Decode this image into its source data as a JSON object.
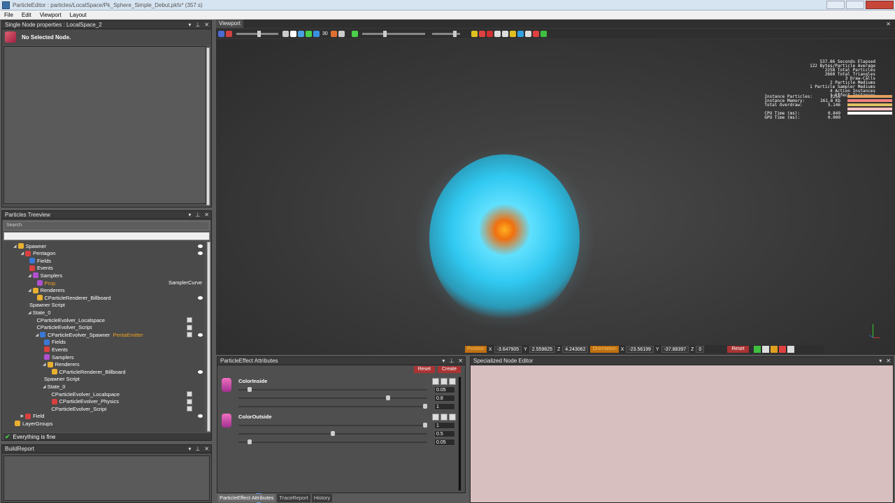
{
  "window": {
    "title": "ParticleEditor : particles/LocalSpace/Pk_Sphere_Simple_Debut.pkfx* (357 s)"
  },
  "menu": [
    "File",
    "Edit",
    "Viewport",
    "Layout"
  ],
  "node_props": {
    "title": "Single Node properties : LocalSpace_2",
    "no_selection": "No Selected Node."
  },
  "treeview": {
    "title": "Particles Treeview",
    "search_label": "Search",
    "rows": [
      {
        "label": "Spawner",
        "indent": 0,
        "icon": "folder",
        "tri": "◢"
      },
      {
        "label": "Pentagon",
        "indent": 1,
        "icon": "penta",
        "tri": "◢"
      },
      {
        "label": "Fields",
        "indent": 2,
        "icon": "blue",
        "tri": ""
      },
      {
        "label": "Events",
        "indent": 2,
        "icon": "penta",
        "tri": ""
      },
      {
        "label": "Samplers",
        "indent": 2,
        "icon": "purple",
        "tri": "◢"
      },
      {
        "label": "Prop",
        "indent": 3,
        "icon": "purple",
        "tri": "",
        "orange": true
      },
      {
        "label": "Renderers",
        "indent": 2,
        "icon": "folder",
        "tri": "◢"
      },
      {
        "label": "CParticleRenderer_Billboard",
        "indent": 3,
        "icon": "folder",
        "tri": ""
      },
      {
        "label": "Spawner Script",
        "indent": 2,
        "icon": "sphere",
        "tri": ""
      },
      {
        "label": "State_0",
        "indent": 2,
        "icon": "sphere",
        "tri": "◢"
      },
      {
        "label": "CParticleEvolver_Localspace",
        "indent": 3,
        "icon": "sphere",
        "tri": ""
      },
      {
        "label": "CParticleEvolver_Script",
        "indent": 3,
        "icon": "sphere",
        "tri": ""
      },
      {
        "label": "CParticleEvolver_Spawner",
        "indent": 3,
        "icon": "blue",
        "tri": "◢",
        "suffix": "PentaEmitter"
      },
      {
        "label": "Fields",
        "indent": 4,
        "icon": "blue",
        "tri": ""
      },
      {
        "label": "Events",
        "indent": 4,
        "icon": "penta",
        "tri": ""
      },
      {
        "label": "Samplers",
        "indent": 4,
        "icon": "purple",
        "tri": ""
      },
      {
        "label": "Renderers",
        "indent": 4,
        "icon": "folder",
        "tri": "◢"
      },
      {
        "label": "CParticleRenderer_Billboard",
        "indent": 5,
        "icon": "folder",
        "tri": ""
      },
      {
        "label": "Spawner Script",
        "indent": 4,
        "icon": "sphere",
        "tri": ""
      },
      {
        "label": "State_0",
        "indent": 4,
        "icon": "sphere",
        "tri": "◢"
      },
      {
        "label": "CParticleEvolver_Localspace",
        "indent": 5,
        "icon": "sphere",
        "tri": ""
      },
      {
        "label": "CParticleEvolver_Physics",
        "indent": 5,
        "icon": "penta",
        "tri": ""
      },
      {
        "label": "CParticleEvolver_Script",
        "indent": 5,
        "icon": "sphere",
        "tri": ""
      },
      {
        "label": "Field",
        "indent": 1,
        "icon": "penta",
        "tri": "▶"
      },
      {
        "label": "LayerGroups",
        "indent": 0,
        "icon": "folder",
        "tri": ""
      }
    ],
    "sampler_curve": "SamplerCurve",
    "status": "Everything is fine"
  },
  "build_report": {
    "title": "BuildReport"
  },
  "viewport": {
    "tab": "Viewport",
    "toolbar_value": "30",
    "stats_right": [
      "537.86 Seconds Elapsed",
      "122 Bytes/Particle Average",
      "2258 Total Particles",
      "2660 Total Triangles",
      "3 Draw-Calls",
      "2 Particle Mediums",
      "1 Particle Sampler Mediums",
      "4 Action Instances",
      "1 Effect Instances"
    ],
    "stats2_labels": [
      "Instance Particles:",
      "Instance Memory:",
      "Total Overdraw:",
      "",
      "CPU Time (ms):",
      "GPU Time (ms):"
    ],
    "stats2_values": [
      "2258",
      "261.8 Kb",
      "5.146",
      "",
      "0.849",
      "0.000"
    ],
    "position_label": "Position",
    "orientation_label": "Orientation",
    "pos_x": "-3.647905",
    "pos_y": "2.559825",
    "pos_z": "4.243062",
    "rot_x": "-23.56199",
    "rot_y": "-37.88397",
    "rot_z": "0",
    "reset": "Reset",
    "axes": {
      "x": "X",
      "y": "Y",
      "z": "Z"
    }
  },
  "attributes": {
    "title": "ParticleEffect Attributes",
    "reset": "Reset",
    "create": "Create",
    "items": [
      {
        "name": "ColorInside",
        "values": [
          "0.05",
          "0.8",
          "1"
        ],
        "levels": [
          0.05,
          0.8,
          1
        ]
      },
      {
        "name": "ColorOutside",
        "values": [
          "1",
          "0.5",
          "0.05"
        ],
        "levels": [
          1,
          0.5,
          0.05
        ]
      }
    ]
  },
  "bottom_tabs": [
    "ParticleEffect Attributes",
    "TraceReport",
    "History"
  ],
  "specialized": {
    "title": "Specialized Node Editor"
  },
  "colors": {
    "accent_orange": "#f0a020",
    "reset_red": "#aa3333",
    "specialized_bg": "#d8bfbf"
  }
}
